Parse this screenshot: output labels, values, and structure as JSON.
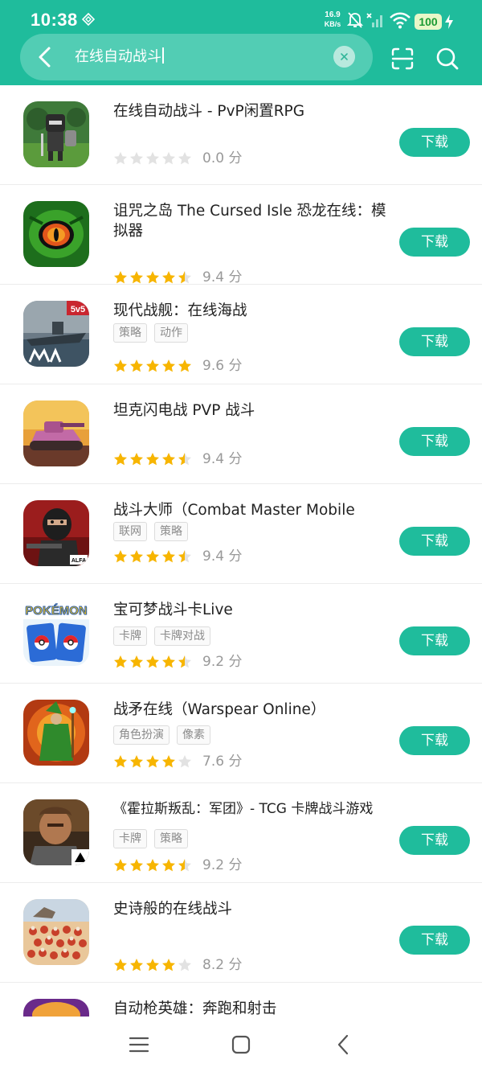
{
  "status_bar": {
    "time": "10:38",
    "net_speed_value": "16.9",
    "net_speed_unit": "KB/s",
    "battery": "100"
  },
  "search": {
    "query": "在线自动战斗"
  },
  "colors": {
    "accent": "#1fbc9c",
    "star_on": "#f7b500",
    "star_off": "#e2e2e2"
  },
  "results": [
    {
      "title": "在线自动战斗 - PvP闲置RPG",
      "tags": [],
      "rating": 0.0,
      "score": "0.0 分",
      "button": "下载",
      "icon": "knight-game-icon"
    },
    {
      "title": "诅咒之岛 The Cursed Isle 恐龙在线：模拟器",
      "tags": [],
      "rating": 4.5,
      "score": "9.4 分",
      "button": "下载",
      "icon": "dragon-eye-game-icon"
    },
    {
      "title": "现代战舰：在线海战",
      "tags": [
        "策略",
        "动作"
      ],
      "rating": 5,
      "score": "9.6 分",
      "button": "下载",
      "icon": "warship-game-icon"
    },
    {
      "title": "坦克闪电战 PVP 战斗",
      "tags": [],
      "rating": 4.5,
      "score": "9.4 分",
      "button": "下载",
      "icon": "tank-game-icon"
    },
    {
      "title": "战斗大师（Combat Master Mobile FPS）",
      "tags": [
        "联网",
        "策略"
      ],
      "rating": 4.5,
      "score": "9.4 分",
      "button": "下载",
      "icon": "soldier-game-icon"
    },
    {
      "title": "宝可梦战斗卡Live",
      "tags": [
        "卡牌",
        "卡牌对战"
      ],
      "rating": 4.5,
      "score": "9.2 分",
      "button": "下载",
      "icon": "pokemon-cards-icon"
    },
    {
      "title": "战矛在线（Warspear Online）",
      "tags": [
        "角色扮演",
        "像素"
      ],
      "rating": 4,
      "score": "7.6 分",
      "button": "下载",
      "icon": "wizard-game-icon"
    },
    {
      "title": "《霍拉斯叛乱：军团》- TCG 卡牌战斗游戏",
      "tags": [
        "卡牌",
        "策略"
      ],
      "rating": 4.5,
      "score": "9.2 分",
      "button": "下载",
      "icon": "warrior-game-icon"
    },
    {
      "title": "史诗般的在线战斗",
      "tags": [],
      "rating": 4,
      "score": "8.2 分",
      "button": "下载",
      "icon": "battle-army-icon"
    },
    {
      "title": "自动枪英雄：奔跑和射击",
      "tags": [],
      "rating": 0,
      "score": "",
      "button": "",
      "icon": "hero-game-icon"
    }
  ]
}
